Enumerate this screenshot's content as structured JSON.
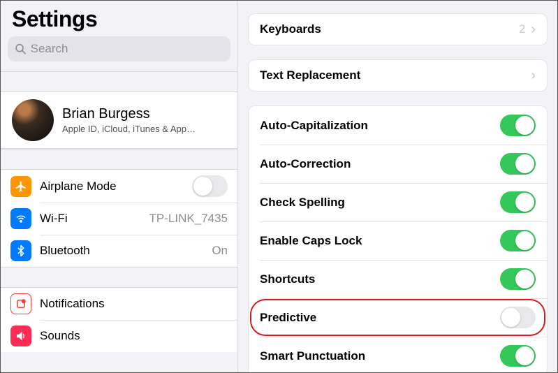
{
  "title": "Settings",
  "search": {
    "placeholder": "Search"
  },
  "profile": {
    "name": "Brian Burgess",
    "subtitle": "Apple ID, iCloud, iTunes & App…"
  },
  "sidebar": [
    {
      "label": "Airplane Mode",
      "kind": "toggle",
      "on": false,
      "iconColor": "#ff9500",
      "icon": "airplane"
    },
    {
      "label": "Wi-Fi",
      "kind": "value",
      "value": "TP-LINK_7435",
      "iconColor": "#007aff",
      "icon": "wifi"
    },
    {
      "label": "Bluetooth",
      "kind": "value",
      "value": "On",
      "iconColor": "#007aff",
      "icon": "bluetooth"
    }
  ],
  "sidebar2": [
    {
      "label": "Notifications",
      "kind": "none",
      "iconColor": "#ff3b30",
      "icon": "notifications"
    },
    {
      "label": "Sounds",
      "kind": "none",
      "iconColor": "#ff2d55",
      "icon": "sounds"
    }
  ],
  "detail": {
    "nav1": {
      "label": "Keyboards",
      "value": "2"
    },
    "nav2": {
      "label": "Text Replacement"
    },
    "toggles": [
      {
        "label": "Auto-Capitalization",
        "on": true
      },
      {
        "label": "Auto-Correction",
        "on": true
      },
      {
        "label": "Check Spelling",
        "on": true
      },
      {
        "label": "Enable Caps Lock",
        "on": true
      },
      {
        "label": "Shortcuts",
        "on": true
      },
      {
        "label": "Predictive",
        "on": false,
        "highlight": true
      },
      {
        "label": "Smart Punctuation",
        "on": true
      }
    ]
  }
}
